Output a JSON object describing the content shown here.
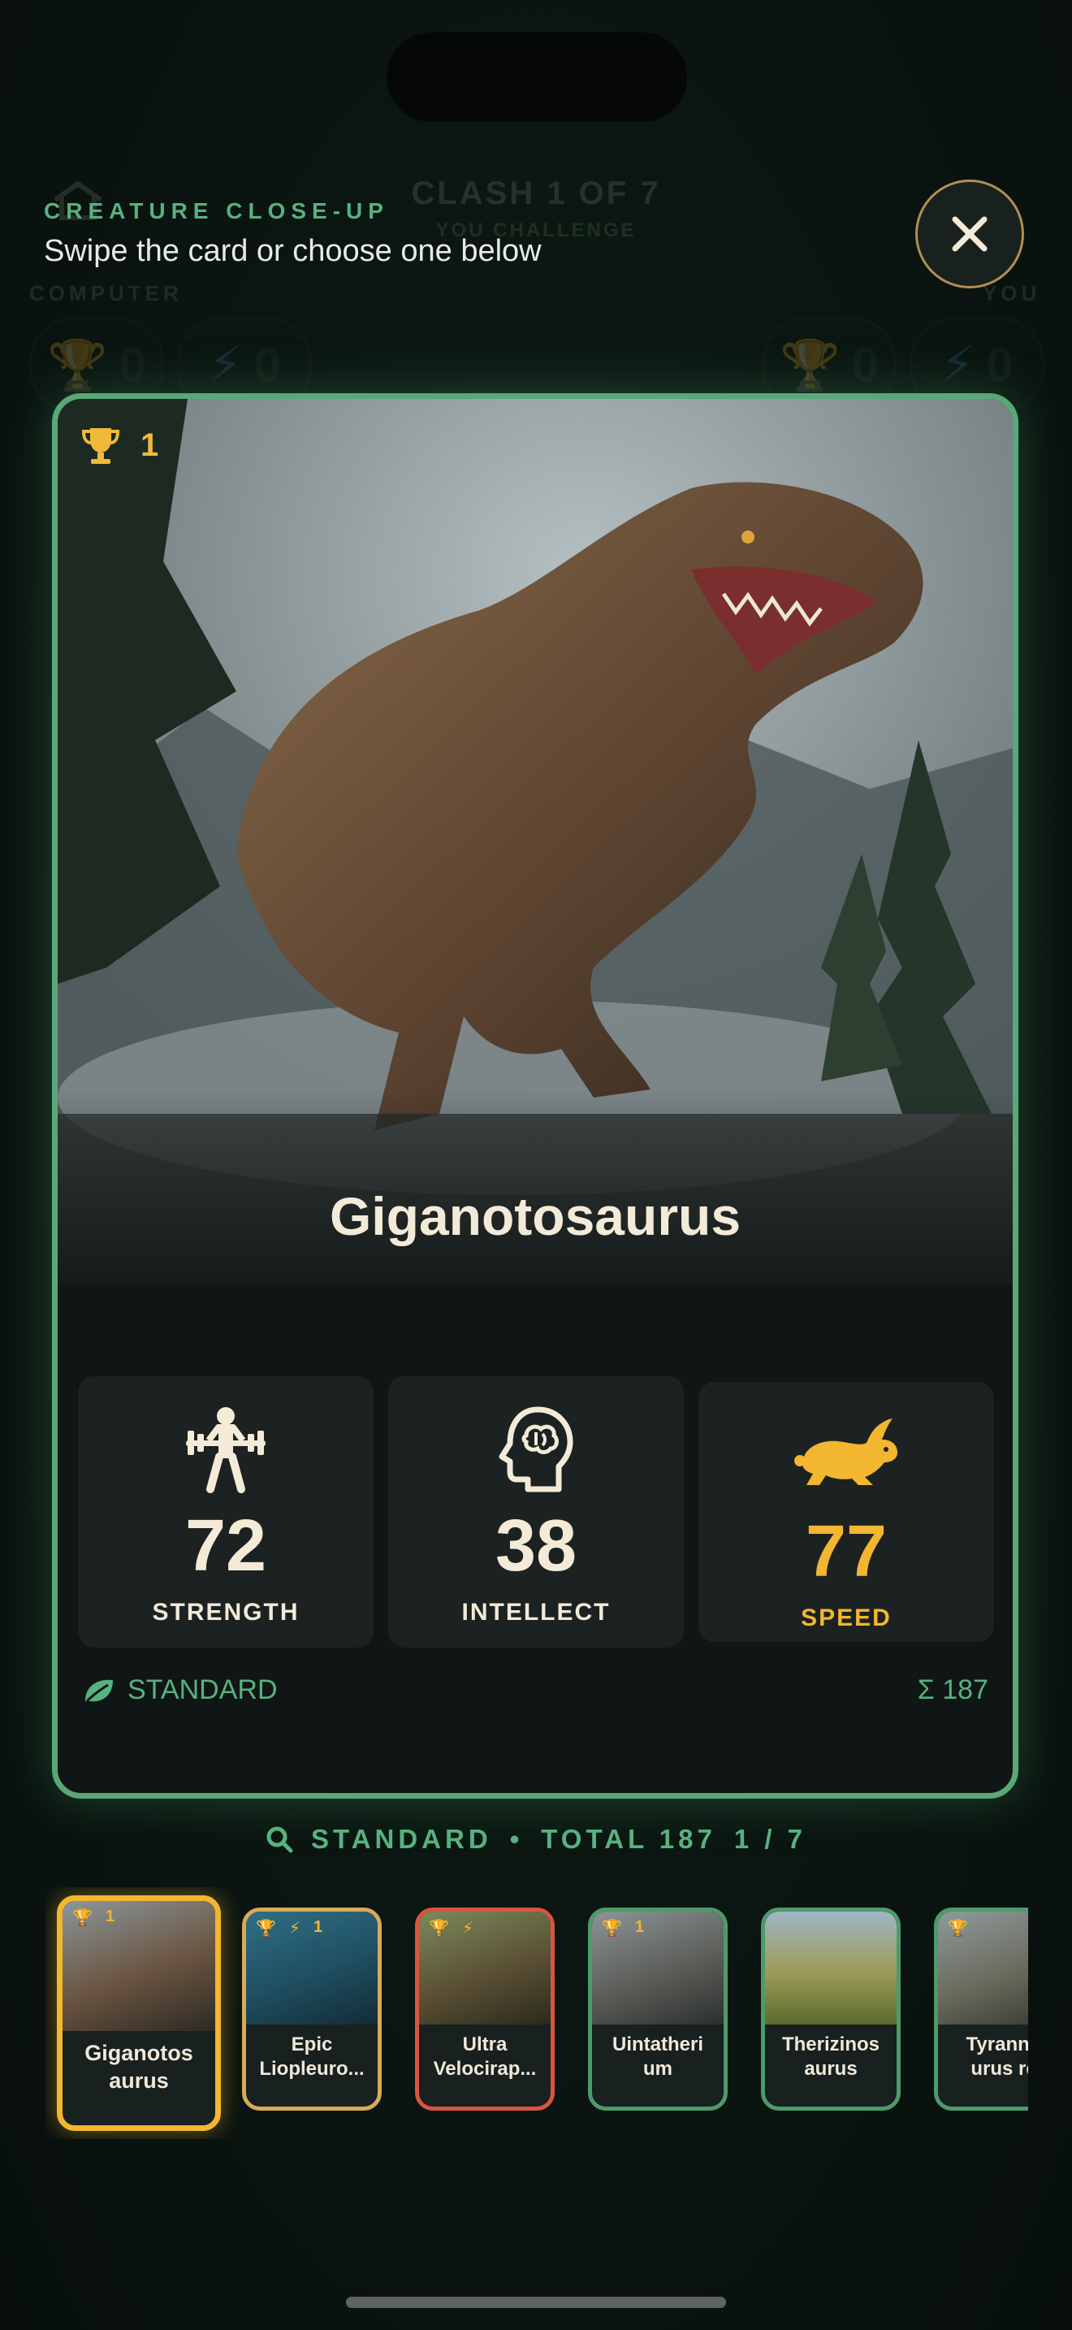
{
  "background": {
    "round_title": "CLASH 1 OF 7",
    "round_sub": "YOU CHALLENGE",
    "left_player": "COMPUTER",
    "right_player": "YOU",
    "scores": [
      "0",
      "0",
      "0",
      "0"
    ]
  },
  "header": {
    "eyebrow": "CREATURE CLOSE-UP",
    "subtitle": "Swipe the card or choose one below",
    "close_icon": "close-icon"
  },
  "card": {
    "trophies": "1",
    "name": "Giganotosaurus",
    "stats": [
      {
        "label": "STRENGTH",
        "value": "72",
        "icon": "weightlifter-icon",
        "selected": false
      },
      {
        "label": "INTELLECT",
        "value": "38",
        "icon": "brain-head-icon",
        "selected": false
      },
      {
        "label": "SPEED",
        "value": "77",
        "icon": "rabbit-icon",
        "selected": true
      }
    ],
    "rarity": "STANDARD",
    "total": "Σ 187"
  },
  "summary": {
    "rarity": "STANDARD",
    "total": "TOTAL 187",
    "position": "1 / 7"
  },
  "thumbnails": [
    {
      "name": "Giganotos aurus",
      "line1": "Giganotos",
      "line2": "aurus",
      "trophy": "1",
      "bolt": "",
      "tier": "standard",
      "selected": true
    },
    {
      "name": "Epic Liopleuro...",
      "line1": "Epic",
      "line2": "Liopleuro...",
      "trophy": "",
      "bolt": "1",
      "tier": "epic",
      "selected": false
    },
    {
      "name": "Ultra Velocirap...",
      "line1": "Ultra",
      "line2": "Velocirap...",
      "trophy": "",
      "bolt": "",
      "tier": "ultra",
      "selected": false
    },
    {
      "name": "Uintatheri um",
      "line1": "Uintatheri",
      "line2": "um",
      "trophy": "1",
      "bolt": "",
      "tier": "standard",
      "selected": false
    },
    {
      "name": "Therizinos aurus",
      "line1": "Therizinos",
      "line2": "aurus",
      "trophy": "",
      "bolt": "",
      "tier": "standard",
      "selected": false
    },
    {
      "name": "Tyranno urus re",
      "line1": "Tyranno",
      "line2": "urus re",
      "trophy": "",
      "bolt": "",
      "tier": "standard",
      "selected": false
    }
  ],
  "colors": {
    "accent_green": "#57b27d",
    "gold": "#f2b630",
    "card_border": "#5aa878",
    "ultra_red": "#d8553e"
  }
}
